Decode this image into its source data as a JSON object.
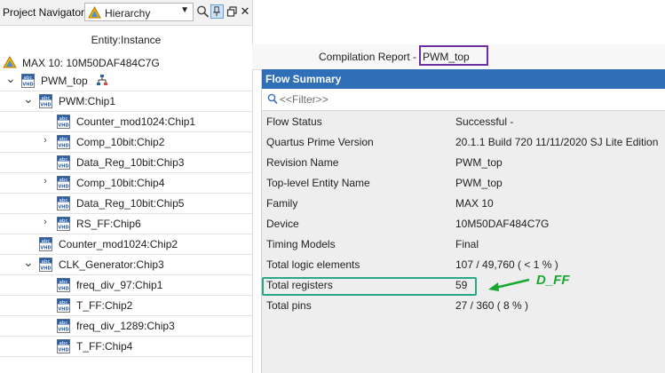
{
  "navigator": {
    "title": "Project Navigator",
    "view_selector": {
      "value": "Hierarchy"
    },
    "toolbar_icons": [
      "search-icon",
      "pin-icon",
      "restore-icon",
      "close-icon"
    ],
    "column_header": "Entity:Instance",
    "device": "MAX 10: 10M50DAF484C7G",
    "tree": [
      {
        "label": "PWM_top",
        "expander": "expanded",
        "icon": "vhdl-file-icon",
        "badge": "hierarchy-icon"
      },
      {
        "label": "PWM:Chip1",
        "expander": "expanded",
        "icon": "vhdl-file-icon"
      },
      {
        "label": "Counter_mod1024:Chip1",
        "expander": "none",
        "icon": "vhdl-file-icon"
      },
      {
        "label": "Comp_10bit:Chip2",
        "expander": "collapsed",
        "icon": "vhdl-file-icon"
      },
      {
        "label": "Data_Reg_10bit:Chip3",
        "expander": "none",
        "icon": "vhdl-file-icon"
      },
      {
        "label": "Comp_10bit:Chip4",
        "expander": "collapsed",
        "icon": "vhdl-file-icon"
      },
      {
        "label": "Data_Reg_10bit:Chip5",
        "expander": "none",
        "icon": "vhdl-file-icon"
      },
      {
        "label": "RS_FF:Chip6",
        "expander": "collapsed",
        "icon": "vhdl-file-icon"
      },
      {
        "label": "Counter_mod1024:Chip2",
        "expander": "none",
        "icon": "vhdl-file-icon"
      },
      {
        "label": "CLK_Generator:Chip3",
        "expander": "expanded",
        "icon": "vhdl-file-icon"
      },
      {
        "label": "freq_div_97:Chip1",
        "expander": "none",
        "icon": "vhdl-file-icon"
      },
      {
        "label": "T_FF:Chip2",
        "expander": "none",
        "icon": "vhdl-file-icon"
      },
      {
        "label": "freq_div_1289:Chip3",
        "expander": "none",
        "icon": "vhdl-file-icon"
      },
      {
        "label": "T_FF:Chip4",
        "expander": "none",
        "icon": "vhdl-file-icon"
      }
    ]
  },
  "report": {
    "title_prefix": "Compilation Report -",
    "title_name": "PWM_top",
    "section_header": "Flow Summary",
    "filter_placeholder": "<<Filter>>",
    "rows": [
      {
        "key": "Flow Status",
        "value": "Successful -"
      },
      {
        "key": "Quartus Prime Version",
        "value": "20.1.1 Build 720 11/11/2020 SJ Lite Edition"
      },
      {
        "key": "Revision Name",
        "value": "PWM_top"
      },
      {
        "key": "Top-level Entity Name",
        "value": "PWM_top"
      },
      {
        "key": "Family",
        "value": "MAX 10"
      },
      {
        "key": "Device",
        "value": "10M50DAF484C7G"
      },
      {
        "key": "Timing Models",
        "value": "Final"
      },
      {
        "key": "Total logic elements",
        "value": "107 / 49,760 ( < 1 % )"
      },
      {
        "key": "Total registers",
        "value": "59"
      },
      {
        "key": "Total pins",
        "value": "27 / 360 ( 8 % )"
      }
    ]
  },
  "annotation": {
    "label": "D_FF",
    "color": "#18a832",
    "box_color": "#28a887",
    "title_box_color": "#6b2fa0"
  },
  "colors": {
    "accent": "#2f6fb7"
  }
}
